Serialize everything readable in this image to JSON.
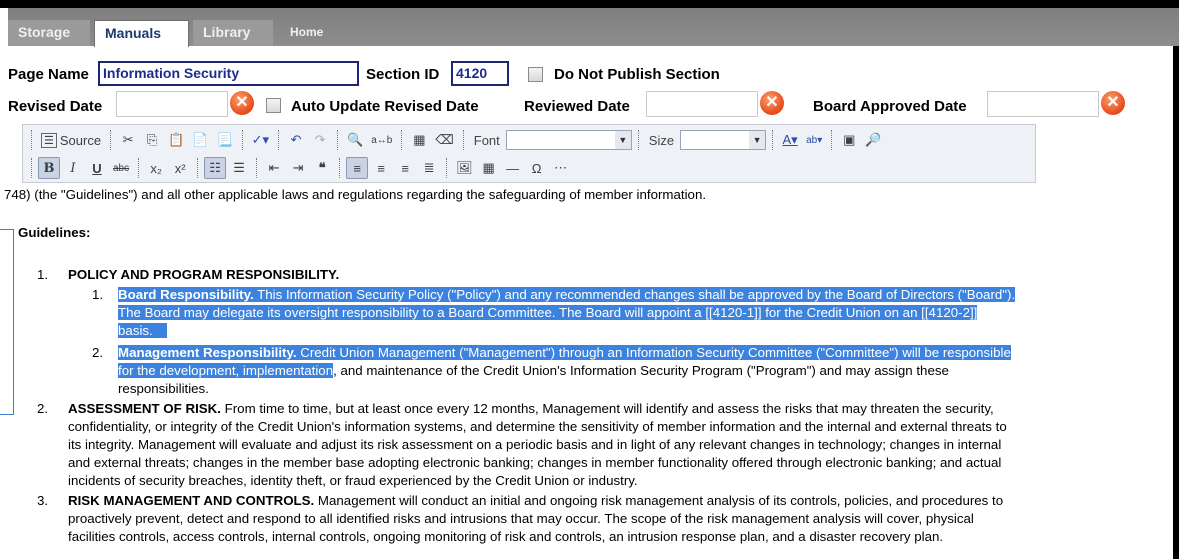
{
  "tabs": [
    {
      "label": "Storage",
      "active": false
    },
    {
      "label": "Manuals",
      "active": true
    },
    {
      "label": "Library",
      "active": false
    },
    {
      "label": "Home",
      "active": false
    }
  ],
  "form": {
    "page_name_label": "Page Name",
    "page_name_value": "Information Security",
    "section_id_label": "Section ID",
    "section_id_value": "4120",
    "do_not_publish_label": "Do Not Publish Section",
    "revised_date_label": "Revised Date",
    "auto_update_label": "Auto Update Revised Date",
    "reviewed_date_label": "Reviewed Date",
    "board_approved_label": "Board Approved Date",
    "clear_symbol": "✕"
  },
  "toolbar": {
    "source_label": "Source",
    "font_label": "Font",
    "size_label": "Size",
    "bold": "B",
    "italic": "I",
    "underline": "U",
    "strike": "abc",
    "subscript": "x₂",
    "superscript": "x²"
  },
  "content": {
    "intro": "748) (the \"Guidelines\") and all other applicable laws and regulations regarding the safeguarding of member information.",
    "guidelines_heading": "Guidelines:",
    "item1_num": "1.",
    "item1_title": "POLICY AND PROGRAM RESPONSIBILITY.",
    "item1_1_num": "1.",
    "item1_1_title": "Board Responsibility.",
    "item1_1_line1": " This Information Security Policy (\"Policy\") and any recommended changes shall be approved by the Board of Directors (\"Board\").",
    "item1_1_line2": "The Board may delegate its oversight responsibility to a Board Committee. The Board will appoint a [[4120-1]] for the Credit Union on an [[4120-2]]",
    "item1_1_line3": "basis.",
    "item1_2_num": "2.",
    "item1_2_title": "Management Responsibility.",
    "item1_2_line1": " Credit Union Management (\"Management\") through an Information Security Committee (\"Committee\") will be responsible",
    "item1_2_line2_hl": "for the development, implementation",
    "item1_2_line2_rest": ", and maintenance of the Credit Union's Information Security Program (\"Program\") and may assign these",
    "item1_2_line3": "responsibilities.",
    "item2_num": "2.",
    "item2_title": "ASSESSMENT OF RISK.",
    "item2_line1": " From time to time, but at least once every 12 months, Management will identify and assess the risks that may threaten the security,",
    "item2_line2": "confidentiality, or integrity of the Credit Union's information systems, and determine the sensitivity of member information and the internal and external threats to",
    "item2_line3": "its integrity. Management will evaluate and adjust its risk assessment on a periodic basis and in light of any relevant changes in technology; changes in internal",
    "item2_line4": "and external threats; changes in the member base adopting electronic banking; changes in member functionality offered through electronic banking; and actual",
    "item2_line5": "incidents of security breaches, identity theft, or fraud experienced by the Credit Union or industry.",
    "item3_num": "3.",
    "item3_title": "RISK MANAGEMENT AND CONTROLS.",
    "item3_line1": " Management will conduct an initial and ongoing risk management analysis of its controls, policies, and procedures to",
    "item3_line2": "proactively prevent, detect and respond to all identified risks and intrusions that may occur. The scope of the risk management analysis will cover, physical",
    "item3_line3": "facilities controls, access controls, internal controls, ongoing monitoring of risk and controls, an intrusion response plan, and a disaster recovery plan."
  },
  "colors": {
    "highlight": "#3b83de",
    "tab_active_text": "#1d3a6e",
    "clear_button": "#e5491a"
  }
}
